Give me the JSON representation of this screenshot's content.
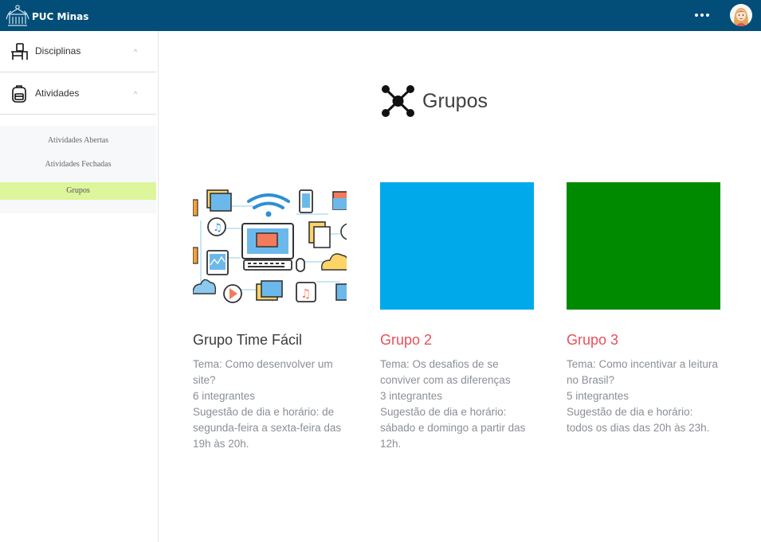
{
  "header": {
    "logo_text": "PUC Minas",
    "colors": {
      "bar": "#034e79"
    }
  },
  "sidebar": {
    "items": [
      {
        "label": "Disciplinas",
        "icon": "desk-icon"
      },
      {
        "label": "Atividades",
        "icon": "backpack-icon"
      }
    ],
    "subitems": [
      {
        "label": "Atividades Abertas"
      },
      {
        "label": "Atividades Fechadas"
      },
      {
        "label": "Grupos",
        "active": true
      }
    ]
  },
  "main": {
    "title": "Grupos",
    "cards": [
      {
        "title": "Grupo Time Fácil",
        "title_color": "#3b3b3b",
        "image": "network-devices-illustration",
        "lines": [
          "Tema: Como desenvolver um site?",
          "6 integrantes",
          "Sugestão de dia e horário: de segunda-feira a sexta-feira das 19h às 20h."
        ]
      },
      {
        "title": "Grupo 2",
        "title_color": "#e8505b",
        "image_color": "#00aaea",
        "lines": [
          "Tema: Os desafios de se conviver com as diferenças",
          "3 integrantes",
          "Sugestão de dia e horário: sábado e domingo a partir das 12h."
        ]
      },
      {
        "title": "Grupo 3",
        "title_color": "#e8505b",
        "image_color": "#008a00",
        "lines": [
          "Tema: Como incentivar a leitura no Brasil?",
          "5 integrantes",
          "Sugestão de dia e horário: todos os dias das 20h às 23h."
        ]
      }
    ]
  }
}
